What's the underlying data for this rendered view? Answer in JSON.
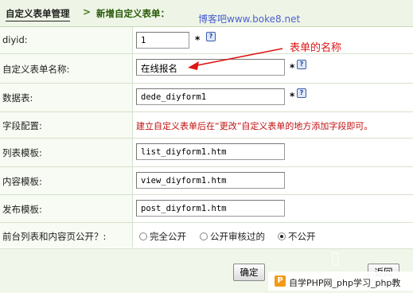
{
  "breadcrumb": {
    "home": "自定义表单管理",
    "separator": ">",
    "current": "新增自定义表单："
  },
  "watermark_top": "博客吧www.boke8.net",
  "annotation": {
    "text": "表单的名称"
  },
  "rows": {
    "diyid": {
      "label": "diyid:",
      "value": "1",
      "required_mark": "*"
    },
    "name": {
      "label": "自定义表单名称:",
      "value": "在线报名",
      "required_mark": "*"
    },
    "table": {
      "label": "数据表:",
      "value": "dede_diyform1",
      "required_mark": "*"
    },
    "fields": {
      "label": "字段配置:",
      "hint": "建立自定义表单后在“更改”自定义表单的地方添加字段即可。"
    },
    "list_tpl": {
      "label": "列表模板:",
      "value": "list_diyform1.htm"
    },
    "content_tpl": {
      "label": "内容模板:",
      "value": "view_diyform1.htm"
    },
    "post_tpl": {
      "label": "发布模板:",
      "value": "post_diyform1.htm"
    },
    "public": {
      "label": "前台列表和内容页公开？:",
      "options": [
        "完全公开",
        "公开审核过的",
        "不公开"
      ],
      "selected": "不公开"
    }
  },
  "buttons": {
    "confirm": "确定",
    "back": "返回"
  },
  "watermark_bottom": {
    "logo": "P",
    "text": "自学PHP网_php学习_php教"
  },
  "colors": {
    "accent_red": "#e01515",
    "header_bg": "#eef5e6",
    "label_bg": "#f7fbf3"
  }
}
